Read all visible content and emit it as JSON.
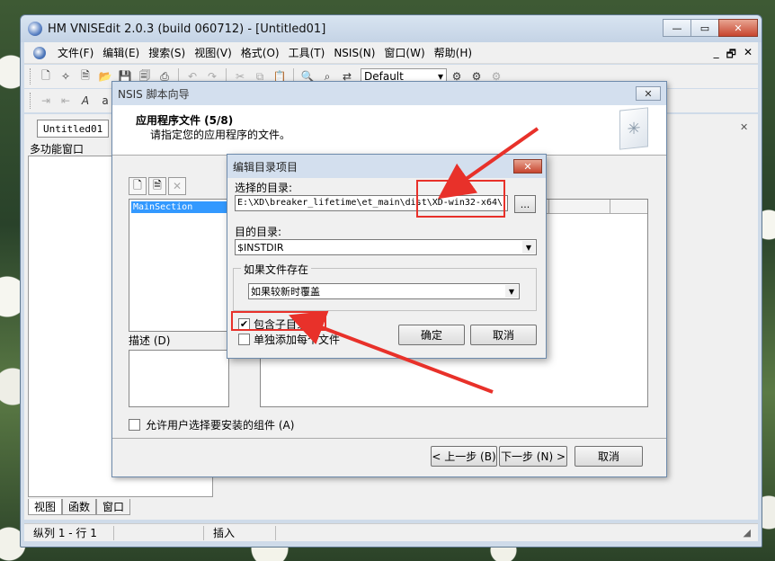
{
  "app": {
    "title": "HM VNISEdit 2.0.3 (build 060712) - [Untitled01]",
    "window_buttons": [
      "—",
      "▭",
      "✕"
    ]
  },
  "menubar": {
    "items": [
      "文件(F)",
      "编辑(E)",
      "搜索(S)",
      "视图(V)",
      "格式(O)",
      "工具(T)",
      "NSIS(N)",
      "窗口(W)",
      "帮助(H)"
    ],
    "mdi_buttons": [
      "_",
      "🗗",
      "✕"
    ]
  },
  "toolbar": {
    "scheme": "Default"
  },
  "editor": {
    "doc_tab": "Untitled01",
    "panel_title": "多功能窗口",
    "panel_tabs": [
      "视图",
      "函数",
      "窗口"
    ]
  },
  "statusbar": {
    "position": "纵列 1 - 行 1",
    "mode": "插入"
  },
  "wizard": {
    "title": "NSIS 脚本向导",
    "heading": "应用程序文件 (5/8)",
    "subheading": "请指定您的应用程序的文件。",
    "sections": [
      "MainSection"
    ],
    "description_label": "描述 (D)",
    "allow_user_select": "允许用户选择要安装的组件 (A)",
    "buttons": {
      "back": "< 上一步 (B)",
      "next": "下一步 (N) >",
      "cancel": "取消"
    }
  },
  "edit_dialog": {
    "title": "编辑目录项目",
    "source_label": "选择的目录:",
    "source_value": "E:\\XD\\breaker_lifetime\\et_main\\dist\\XD-win32-x64\\",
    "browse_label": "...",
    "dest_label": "目的目录:",
    "dest_value": "$INSTDIR",
    "overwrite_group": "如果文件存在",
    "overwrite_value": "如果较新时覆盖",
    "include_subdirs": "包含子目录",
    "include_subdirs_checked": true,
    "add_each_file": "单独添加每个文件",
    "add_each_file_checked": false,
    "ok": "确定",
    "cancel": "取消"
  },
  "colors": {
    "annotation": "#e8312a",
    "selection": "#3399ff"
  }
}
